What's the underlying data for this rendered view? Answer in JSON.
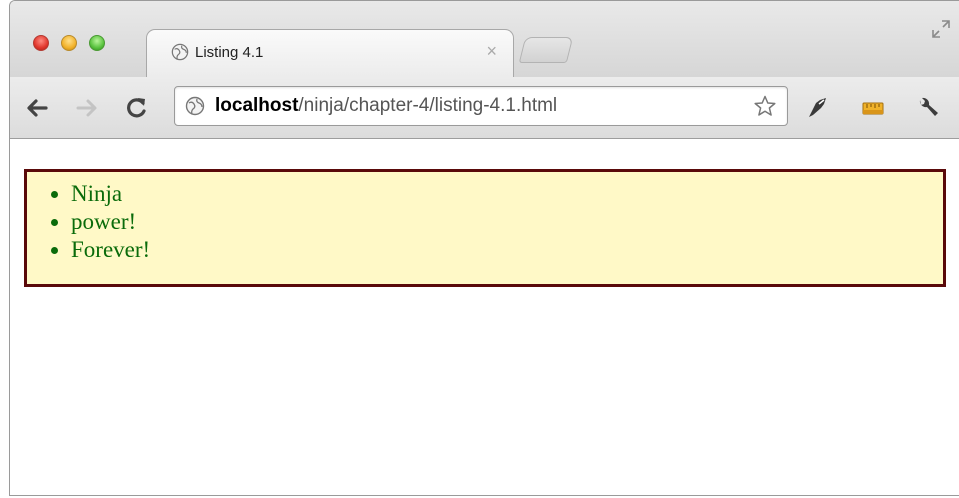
{
  "window": {
    "tab_title": "Listing 4.1",
    "tab_close": "×"
  },
  "omnibox": {
    "host": "localhost",
    "path": "/ninja/chapter-4/listing-4.1.html"
  },
  "icons": {
    "back": "back-arrow-icon",
    "forward": "forward-arrow-icon",
    "reload": "reload-icon",
    "globe": "globe-icon",
    "star": "bookmark-star-icon",
    "ext1": "extension-icon",
    "ext2": "ruler-icon",
    "wrench": "wrench-icon",
    "fullscreen": "fullscreen-icon"
  },
  "page": {
    "items": [
      "Ninja",
      "power!",
      "Forever!"
    ]
  },
  "colors": {
    "list_text": "#0a6b0a",
    "list_bg": "#fff9c7",
    "list_border": "#5a0a0a"
  }
}
